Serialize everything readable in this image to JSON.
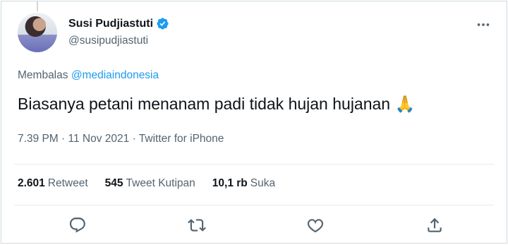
{
  "author": {
    "display_name": "Susi Pudjiastuti",
    "handle": "@susipudjiastuti"
  },
  "reply": {
    "prefix": "Membalas",
    "target": "@mediaindonesia"
  },
  "tweet": {
    "text": "Biasanya petani menanam padi tidak hujan hujanan",
    "emoji": "🙏"
  },
  "meta": {
    "time": "7.39 PM",
    "date": "11 Nov 2021",
    "source": "Twitter for iPhone",
    "separator": "·"
  },
  "stats": [
    {
      "value": "2.601",
      "label": "Retweet"
    },
    {
      "value": "545",
      "label": "Tweet Kutipan"
    },
    {
      "value": "10,1 rb",
      "label": "Suka"
    }
  ],
  "more_icon": "more-dots-icon",
  "colors": {
    "accent": "#1d9bf0",
    "secondary_text": "#536471",
    "primary_text": "#0f1419",
    "divider": "#e6ecf0"
  },
  "icons": [
    "reply-icon",
    "retweet-icon",
    "like-icon",
    "share-icon",
    "verified-badge-icon"
  ]
}
